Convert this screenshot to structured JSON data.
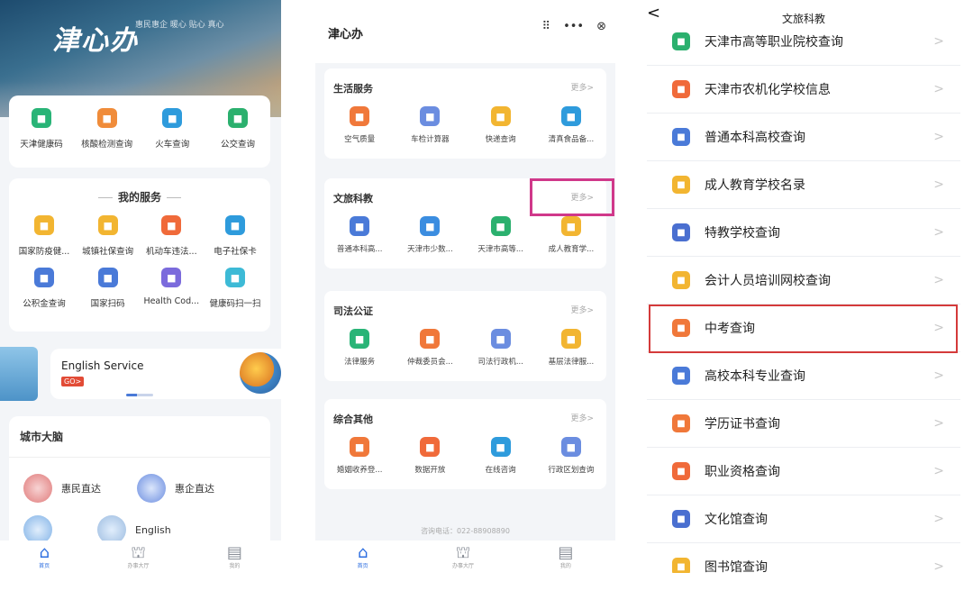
{
  "colors": {
    "accent": "#2d6ee0",
    "highlight_pink": "#d0388a",
    "highlight_red": "#d43a3a"
  },
  "phone1": {
    "brand": "津心办",
    "banner_tag": "惠民惠企 暖心 贴心 真心",
    "quick_services": [
      {
        "label": "天津健康码",
        "icon": "qr-icon",
        "color": "#29b477"
      },
      {
        "label": "核酸检测查询",
        "icon": "test-icon",
        "color": "#f08c3a"
      },
      {
        "label": "火车查询",
        "icon": "train-icon",
        "color": "#2e9bdc"
      },
      {
        "label": "公交查询",
        "icon": "bus-icon",
        "color": "#2bb06e"
      }
    ],
    "my_services_title": "我的服务",
    "my_services": [
      {
        "label": "国家防疫健...",
        "icon": "grid-icon",
        "color": "#f2b531"
      },
      {
        "label": "城镇社保查询",
        "icon": "shield-icon",
        "color": "#f2b531"
      },
      {
        "label": "机动车违法...",
        "icon": "car-icon",
        "color": "#f06a3a"
      },
      {
        "label": "电子社保卡",
        "icon": "card-icon",
        "color": "#2e9bdc"
      },
      {
        "label": "公积金查询",
        "icon": "house-icon",
        "color": "#4a7ad8"
      },
      {
        "label": "国家扫码",
        "icon": "scan-icon",
        "color": "#4a7ad8"
      },
      {
        "label": "Health Cod...",
        "icon": "health-icon",
        "color": "#7b6bdc"
      },
      {
        "label": "健康码扫一扫",
        "icon": "scan2-icon",
        "color": "#3dbad6"
      }
    ],
    "english_banner": {
      "text": "English  Service",
      "go": "GO>"
    },
    "city_title": "城市大脑",
    "city_items": [
      {
        "label": "惠民直达"
      },
      {
        "label": "惠企直达"
      },
      {
        "label": ""
      },
      {
        "label": "English"
      }
    ],
    "tabs": [
      "首页",
      "办事大厅",
      "我的"
    ]
  },
  "phone2": {
    "title": "津心办",
    "capsule": [
      "⠿",
      "•••",
      "⊗"
    ],
    "sections": [
      {
        "title": "生活服务",
        "more": "更多>",
        "items": [
          {
            "label": "空气质量",
            "icon": "cloud-icon",
            "color": "#f0783a"
          },
          {
            "label": "车检计算器",
            "icon": "calc-icon",
            "color": "#6b8de0"
          },
          {
            "label": "快递查询",
            "icon": "box-icon",
            "color": "#f2b531"
          },
          {
            "label": "清真食品备...",
            "icon": "food-icon",
            "color": "#2e9bdc"
          }
        ]
      },
      {
        "title": "文旅科教",
        "more": "更多>",
        "items": [
          {
            "label": "普通本科高...",
            "icon": "book-icon",
            "color": "#4a7ad8"
          },
          {
            "label": "天津市少数...",
            "icon": "people-icon",
            "color": "#3b8de0"
          },
          {
            "label": "天津市高等...",
            "icon": "building-icon",
            "color": "#2bb06e"
          },
          {
            "label": "成人教育学...",
            "icon": "coin-icon",
            "color": "#f2b531"
          }
        ]
      },
      {
        "title": "司法公证",
        "more": "更多>",
        "items": [
          {
            "label": "法律服务",
            "icon": "law-icon",
            "color": "#29b477"
          },
          {
            "label": "仲裁委员会...",
            "icon": "doc-icon",
            "color": "#f0783a"
          },
          {
            "label": "司法行政机...",
            "icon": "shield-icon",
            "color": "#6b8de0"
          },
          {
            "label": "基层法律服...",
            "icon": "scale-icon",
            "color": "#f2b531"
          }
        ]
      },
      {
        "title": "综合其他",
        "more": "更多>",
        "items": [
          {
            "label": "婚姻收养登...",
            "icon": "family-icon",
            "color": "#f0783a"
          },
          {
            "label": "数据开放",
            "icon": "data-icon",
            "color": "#f06a3a"
          },
          {
            "label": "在线咨询",
            "icon": "chat-icon",
            "color": "#2e9bdc"
          },
          {
            "label": "行政区划查询",
            "icon": "map-icon",
            "color": "#6b8de0"
          }
        ]
      }
    ],
    "hotline": "咨询电话：022-88908890",
    "tabs": [
      "首页",
      "办事大厅",
      "我的"
    ]
  },
  "phone3": {
    "title": "文旅科教",
    "back": "<",
    "items": [
      {
        "label": "天津市高等职业院校查询",
        "icon": "building-icon",
        "color": "#2bb06e"
      },
      {
        "label": "天津市农机化学校信息",
        "icon": "tractor-icon",
        "color": "#f06a3a"
      },
      {
        "label": "普通本科高校查询",
        "icon": "book-icon",
        "color": "#4a7ad8"
      },
      {
        "label": "成人教育学校名录",
        "icon": "coin-icon",
        "color": "#f2b531"
      },
      {
        "label": "特教学校查询",
        "icon": "triangle-icon",
        "color": "#4a6fd0"
      },
      {
        "label": "会计人员培训网校查询",
        "icon": "person-icon",
        "color": "#f2b531"
      },
      {
        "label": "中考查询",
        "icon": "exam-icon",
        "color": "#f0783a"
      },
      {
        "label": "高校本科专业查询",
        "icon": "book-icon",
        "color": "#4a7ad8"
      },
      {
        "label": "学历证书查询",
        "icon": "cert-icon",
        "color": "#f0783a"
      },
      {
        "label": "职业资格查询",
        "icon": "id-icon",
        "color": "#f06a3a"
      },
      {
        "label": "文化馆查询",
        "icon": "museum-icon",
        "color": "#4a6fd0"
      },
      {
        "label": "图书馆查询",
        "icon": "library-icon",
        "color": "#f2b531"
      }
    ]
  }
}
